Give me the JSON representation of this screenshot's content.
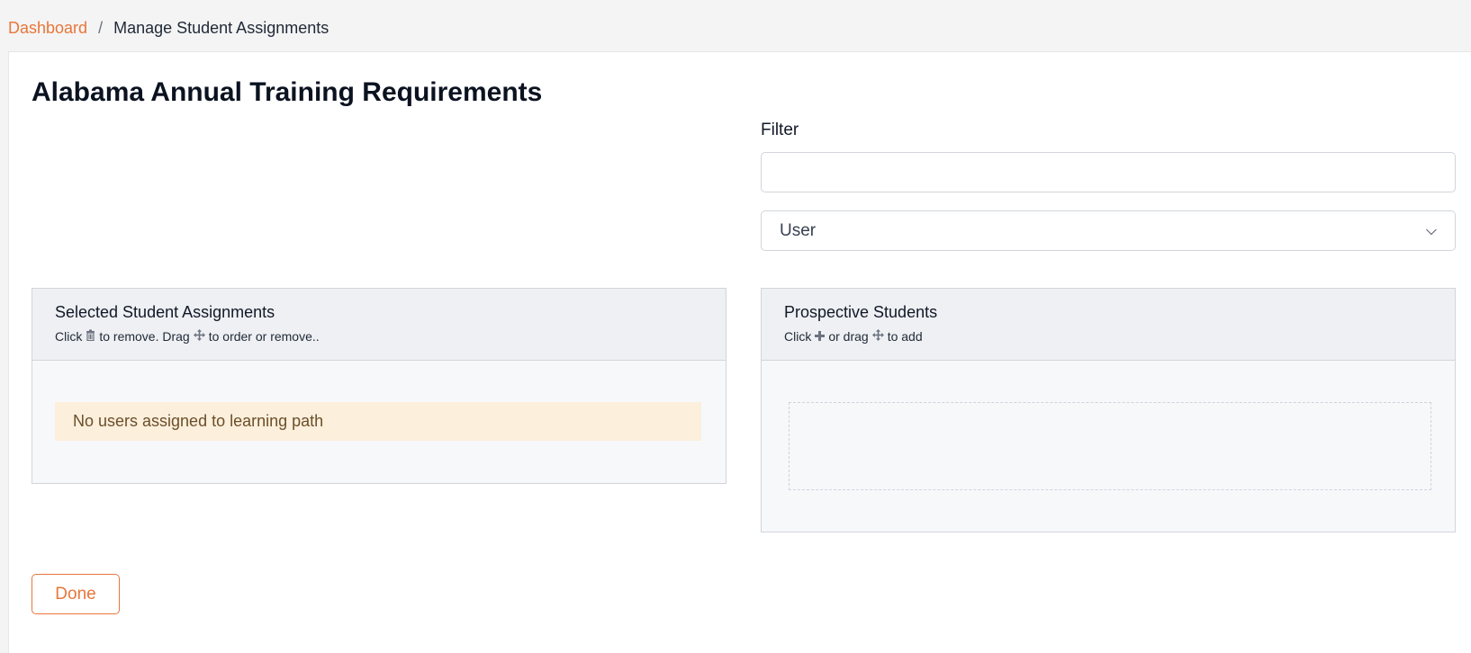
{
  "breadcrumb": {
    "home": "Dashboard",
    "separator": "/",
    "current": "Manage Student Assignments"
  },
  "page": {
    "title": "Alabama Annual Training Requirements"
  },
  "filter": {
    "label": "Filter",
    "input_value": "",
    "select_value": "User"
  },
  "selected_panel": {
    "title": "Selected Student Assignments",
    "sub_click": "Click",
    "sub_remove": "to remove. Drag",
    "sub_order": "to order or remove..",
    "empty_message": "No users assigned to learning path"
  },
  "prospective_panel": {
    "title": "Prospective Students",
    "sub_click": "Click",
    "sub_or_drag": "or drag",
    "sub_add": "to add"
  },
  "actions": {
    "done_label": "Done"
  },
  "colors": {
    "accent": "#e8763a",
    "warning_bg": "#fcefdc"
  }
}
